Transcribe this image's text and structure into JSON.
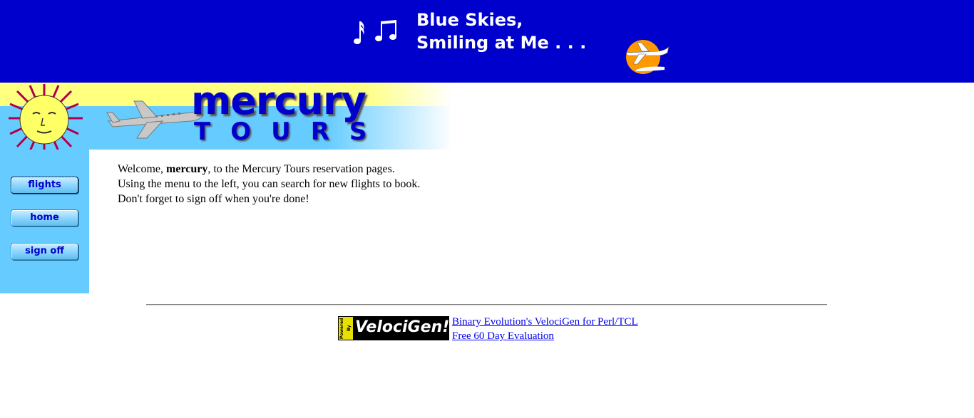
{
  "banner": {
    "tagline": "Blue Skies,\nSmiling at Me . . .",
    "background_color": "#0000cc"
  },
  "logo": {
    "brand_top": "mercury",
    "brand_bottom": "TOURS"
  },
  "nav": {
    "items": [
      {
        "label": "flights",
        "active": true
      },
      {
        "label": "home",
        "active": false
      },
      {
        "label": "sign off",
        "active": false
      }
    ]
  },
  "welcome": {
    "prefix": "Welcome, ",
    "username": "mercury",
    "suffix": ", to the Mercury Tours reservation pages. Using the menu to the left, you can search for new flights to book. Don't forget to sign off when you're done!"
  },
  "footer": {
    "badge_powered": "Powered By",
    "badge_name": "VelociGen!",
    "link1": "Binary Evolution's VelociGen for Perl/TCL",
    "link2": "Free 60 Day Evaluation"
  },
  "colors": {
    "accent_blue": "#0000cc",
    "nav_blue": "#66ccff",
    "logo_yellow": "#ffff80",
    "link": "#0000ee"
  },
  "icons": [
    "music-notes-icon",
    "sunset-airplane-icon",
    "sun-face-icon",
    "airplane-icon"
  ]
}
